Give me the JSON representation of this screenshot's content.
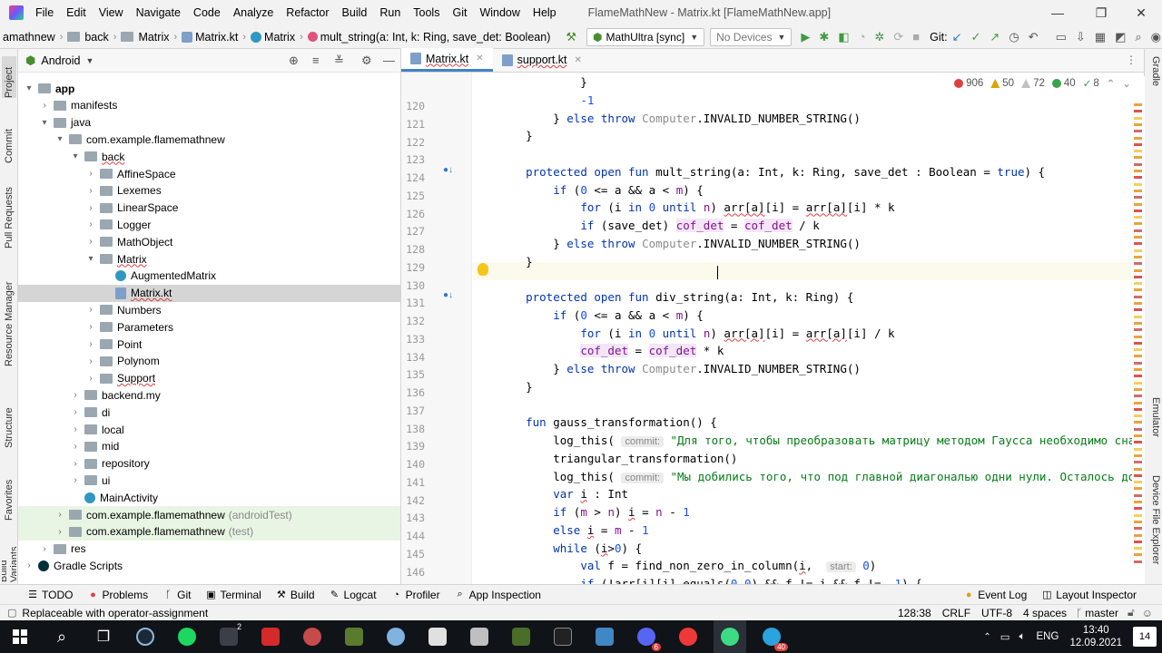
{
  "menu": {
    "items": [
      "File",
      "Edit",
      "View",
      "Navigate",
      "Code",
      "Analyze",
      "Refactor",
      "Build",
      "Run",
      "Tools",
      "Git",
      "Window",
      "Help"
    ],
    "window_title": "FlameMathNew - Matrix.kt [FlameMathNew.app]"
  },
  "navbar": {
    "crumbs": [
      "amathnew",
      "back",
      "Matrix",
      "Matrix.kt",
      "Matrix",
      "mult_string(a: Int, k: Ring, save_det: Boolean)"
    ],
    "run_config": "MathUltra [sync]",
    "device": "No Devices",
    "git_label": "Git:"
  },
  "left_strip": [
    "Project",
    "Commit",
    "Pull Requests",
    "Resource Manager",
    "Structure",
    "Favorites",
    "Build Variants"
  ],
  "project": {
    "view": "Android",
    "tree": [
      {
        "label": "app",
        "depth": 0,
        "arrow": "▾",
        "icon": "folder",
        "bold": true
      },
      {
        "label": "manifests",
        "depth": 1,
        "arrow": "›",
        "icon": "folder"
      },
      {
        "label": "java",
        "depth": 1,
        "arrow": "▾",
        "icon": "folder"
      },
      {
        "label": "com.example.flamemathnew",
        "depth": 2,
        "arrow": "▾",
        "icon": "folder"
      },
      {
        "label": "back",
        "depth": 3,
        "arrow": "▾",
        "icon": "folder",
        "red": true
      },
      {
        "label": "AffineSpace",
        "depth": 4,
        "arrow": "›",
        "icon": "folder"
      },
      {
        "label": "Lexemes",
        "depth": 4,
        "arrow": "›",
        "icon": "folder"
      },
      {
        "label": "LinearSpace",
        "depth": 4,
        "arrow": "›",
        "icon": "folder"
      },
      {
        "label": "Logger",
        "depth": 4,
        "arrow": "›",
        "icon": "folder"
      },
      {
        "label": "MathObject",
        "depth": 4,
        "arrow": "›",
        "icon": "folder"
      },
      {
        "label": "Matrix",
        "depth": 4,
        "arrow": "▾",
        "icon": "folder",
        "red": true
      },
      {
        "label": "AugmentedMatrix",
        "depth": 5,
        "arrow": "",
        "icon": "class"
      },
      {
        "label": "Matrix.kt",
        "depth": 5,
        "arrow": "",
        "icon": "file",
        "selected": true,
        "red": true
      },
      {
        "label": "Numbers",
        "depth": 4,
        "arrow": "›",
        "icon": "folder"
      },
      {
        "label": "Parameters",
        "depth": 4,
        "arrow": "›",
        "icon": "folder"
      },
      {
        "label": "Point",
        "depth": 4,
        "arrow": "›",
        "icon": "folder"
      },
      {
        "label": "Polynom",
        "depth": 4,
        "arrow": "›",
        "icon": "folder"
      },
      {
        "label": "Support",
        "depth": 4,
        "arrow": "›",
        "icon": "folder",
        "red": true
      },
      {
        "label": "backend.my",
        "depth": 3,
        "arrow": "›",
        "icon": "folder"
      },
      {
        "label": "di",
        "depth": 3,
        "arrow": "›",
        "icon": "folder"
      },
      {
        "label": "local",
        "depth": 3,
        "arrow": "›",
        "icon": "folder"
      },
      {
        "label": "mid",
        "depth": 3,
        "arrow": "›",
        "icon": "folder"
      },
      {
        "label": "repository",
        "depth": 3,
        "arrow": "›",
        "icon": "folder"
      },
      {
        "label": "ui",
        "depth": 3,
        "arrow": "›",
        "icon": "folder"
      },
      {
        "label": "MainActivity",
        "depth": 3,
        "arrow": "",
        "icon": "class"
      },
      {
        "label": "com.example.flamemathnew",
        "suffix": "(androidTest)",
        "depth": 2,
        "arrow": "›",
        "icon": "folder",
        "test": true
      },
      {
        "label": "com.example.flamemathnew",
        "suffix": "(test)",
        "depth": 2,
        "arrow": "›",
        "icon": "folder",
        "test": true
      },
      {
        "label": "res",
        "depth": 1,
        "arrow": "›",
        "icon": "folder"
      },
      {
        "label": "Gradle Scripts",
        "depth": 0,
        "arrow": "›",
        "icon": "gradle"
      }
    ]
  },
  "editor": {
    "tabs": [
      {
        "label": "Matrix.kt",
        "active": true
      },
      {
        "label": "support.kt",
        "active": false
      }
    ],
    "inspections": {
      "errors": "906",
      "warnings": "50",
      "weak": "72",
      "typos": "40",
      "checks": "8"
    },
    "lines": [
      {
        "n": "120",
        "html": "            }"
      },
      {
        "n": "121",
        "html": "            <span class=\"num\">-1</span>"
      },
      {
        "n": "122",
        "html": "        } <span class=\"kw\">else throw</span> <span class=\"cmt\">Computer</span>.INVALID_NUMBER_STRING()"
      },
      {
        "n": "123",
        "html": "    }"
      },
      {
        "n": "124",
        "html": ""
      },
      {
        "n": "125",
        "html": "    <span class=\"kw\">protected open fun</span> mult_string(a: Int, k: Ring, save_det : Boolean = <span class=\"kw\">true</span>) {"
      },
      {
        "n": "126",
        "html": "        <span class=\"kw\">if</span> (<span class=\"num\">0</span> &lt;= a &amp;&amp; a &lt; <span class=\"prop\">m</span>) {"
      },
      {
        "n": "127",
        "html": "            <span class=\"kw\">for</span> (i <span class=\"kw\">in</span> <span class=\"num\">0</span> <span class=\"kw\">until</span> <span class=\"prop\">n</span>) <span class=\"underline-red\">arr[a]</span>[i] = <span class=\"underline-red\">arr[a]</span>[i] * k"
      },
      {
        "n": "128",
        "html": "            <span class=\"kw\">if</span> (save_det) <span class=\"prop hl-var\">cof_det</span> = <span class=\"prop hl-var\">cof_det</span> / k"
      },
      {
        "n": "129",
        "html": "        } <span class=\"kw\">else throw</span> <span class=\"cmt\">Computer</span>.INVALID_NUMBER_STRING()"
      },
      {
        "n": "130",
        "html": "    }"
      },
      {
        "n": "131",
        "html": ""
      },
      {
        "n": "132",
        "html": "    <span class=\"kw\">protected open fun</span> div_string(a: Int, k: Ring) {"
      },
      {
        "n": "133",
        "html": "        <span class=\"kw\">if</span> (<span class=\"num\">0</span> &lt;= a &amp;&amp; a &lt; <span class=\"prop\">m</span>) {"
      },
      {
        "n": "134",
        "html": "            <span class=\"kw\">for</span> (i <span class=\"kw\">in</span> <span class=\"num\">0</span> <span class=\"kw\">until</span> <span class=\"prop\">n</span>) <span class=\"underline-red\">arr[a]</span>[i] = <span class=\"underline-red\">arr[a]</span>[i] / k"
      },
      {
        "n": "135",
        "html": "            <span class=\"prop hl-var\">cof_det</span> = <span class=\"prop hl-var\">cof_det</span> * k"
      },
      {
        "n": "136",
        "html": "        } <span class=\"kw\">else throw</span> <span class=\"cmt\">Computer</span>.INVALID_NUMBER_STRING()"
      },
      {
        "n": "137",
        "html": "    }"
      },
      {
        "n": "138",
        "html": ""
      },
      {
        "n": "139",
        "html": "    <span class=\"kw\">fun</span> gauss_transformation() {"
      },
      {
        "n": "140",
        "html": "        log_this( <span class=\"hint\">commit:</span> <span class=\"str\">\"Для того, чтобы преобразовать матрицу методом Гаусса необходимо сначала</span>"
      },
      {
        "n": "141",
        "html": "        triangular_transformation()"
      },
      {
        "n": "142",
        "html": "        log_this( <span class=\"hint\">commit:</span> <span class=\"str\">\"Мы добились того, что под главной диагональю одни нули. Осталось добиться</span>"
      },
      {
        "n": "143",
        "html": "        <span class=\"kw\">var</span> <span class=\"underline-red\">i</span> : Int"
      },
      {
        "n": "144",
        "html": "        <span class=\"kw\">if</span> (<span class=\"prop\">m</span> &gt; <span class=\"prop\">n</span>) <span class=\"underline-red\">i</span> = <span class=\"prop\">n</span> - <span class=\"num\">1</span>"
      },
      {
        "n": "145",
        "html": "        <span class=\"kw\">else</span> <span class=\"underline-red\">i</span> = <span class=\"prop\">m</span> - <span class=\"num\">1</span>"
      },
      {
        "n": "146",
        "html": "        <span class=\"kw\">while</span> (<span class=\"underline-red\">i</span>&gt;<span class=\"num\">0</span>) {"
      },
      {
        "n": "147",
        "html": "            <span class=\"kw\">val</span> f = find_non_zero_in_column(<span class=\"underline-red\">i</span>,  <span class=\"hint\">start:</span> <span class=\"num\">0</span>)"
      },
      {
        "n": "148",
        "html": "            <span class=\"kw\">if</span> (!<span class=\"underline-red\">arr[i]</span>[i].equals(<span class=\"num\">0.0</span>) &amp;&amp; f != i &amp;&amp; f != <span class=\"num\">-1</span>) {"
      }
    ]
  },
  "right_strip": [
    "Gradle",
    "Emulator",
    "Device File Explorer"
  ],
  "bottom_tools": {
    "left": [
      {
        "icon": "todo-icon",
        "label": "TODO"
      },
      {
        "icon": "problems-icon",
        "label": "Problems"
      },
      {
        "icon": "git-icon",
        "label": "Git"
      },
      {
        "icon": "terminal-icon",
        "label": "Terminal"
      },
      {
        "icon": "build-icon",
        "label": "Build"
      },
      {
        "icon": "logcat-icon",
        "label": "Logcat"
      },
      {
        "icon": "profiler-icon",
        "label": "Profiler"
      },
      {
        "icon": "app-inspection-icon",
        "label": "App Inspection"
      }
    ],
    "right": [
      {
        "icon": "event-log-icon",
        "label": "Event Log"
      },
      {
        "icon": "layout-inspector-icon",
        "label": "Layout Inspector"
      }
    ]
  },
  "status": {
    "message": "Replaceable with operator-assignment",
    "position": "128:38",
    "line_sep": "CRLF",
    "encoding": "UTF-8",
    "indent": "4 spaces",
    "branch": "master"
  },
  "taskbar": {
    "lang": "ENG",
    "time": "13:40",
    "date": "12.09.2021",
    "notifications": "14",
    "badges": {
      "app2": "2",
      "discord": "6",
      "telegram": "40"
    }
  },
  "colors": {
    "accent": "#4083c9",
    "error": "#e04040",
    "warning": "#e0a200"
  }
}
